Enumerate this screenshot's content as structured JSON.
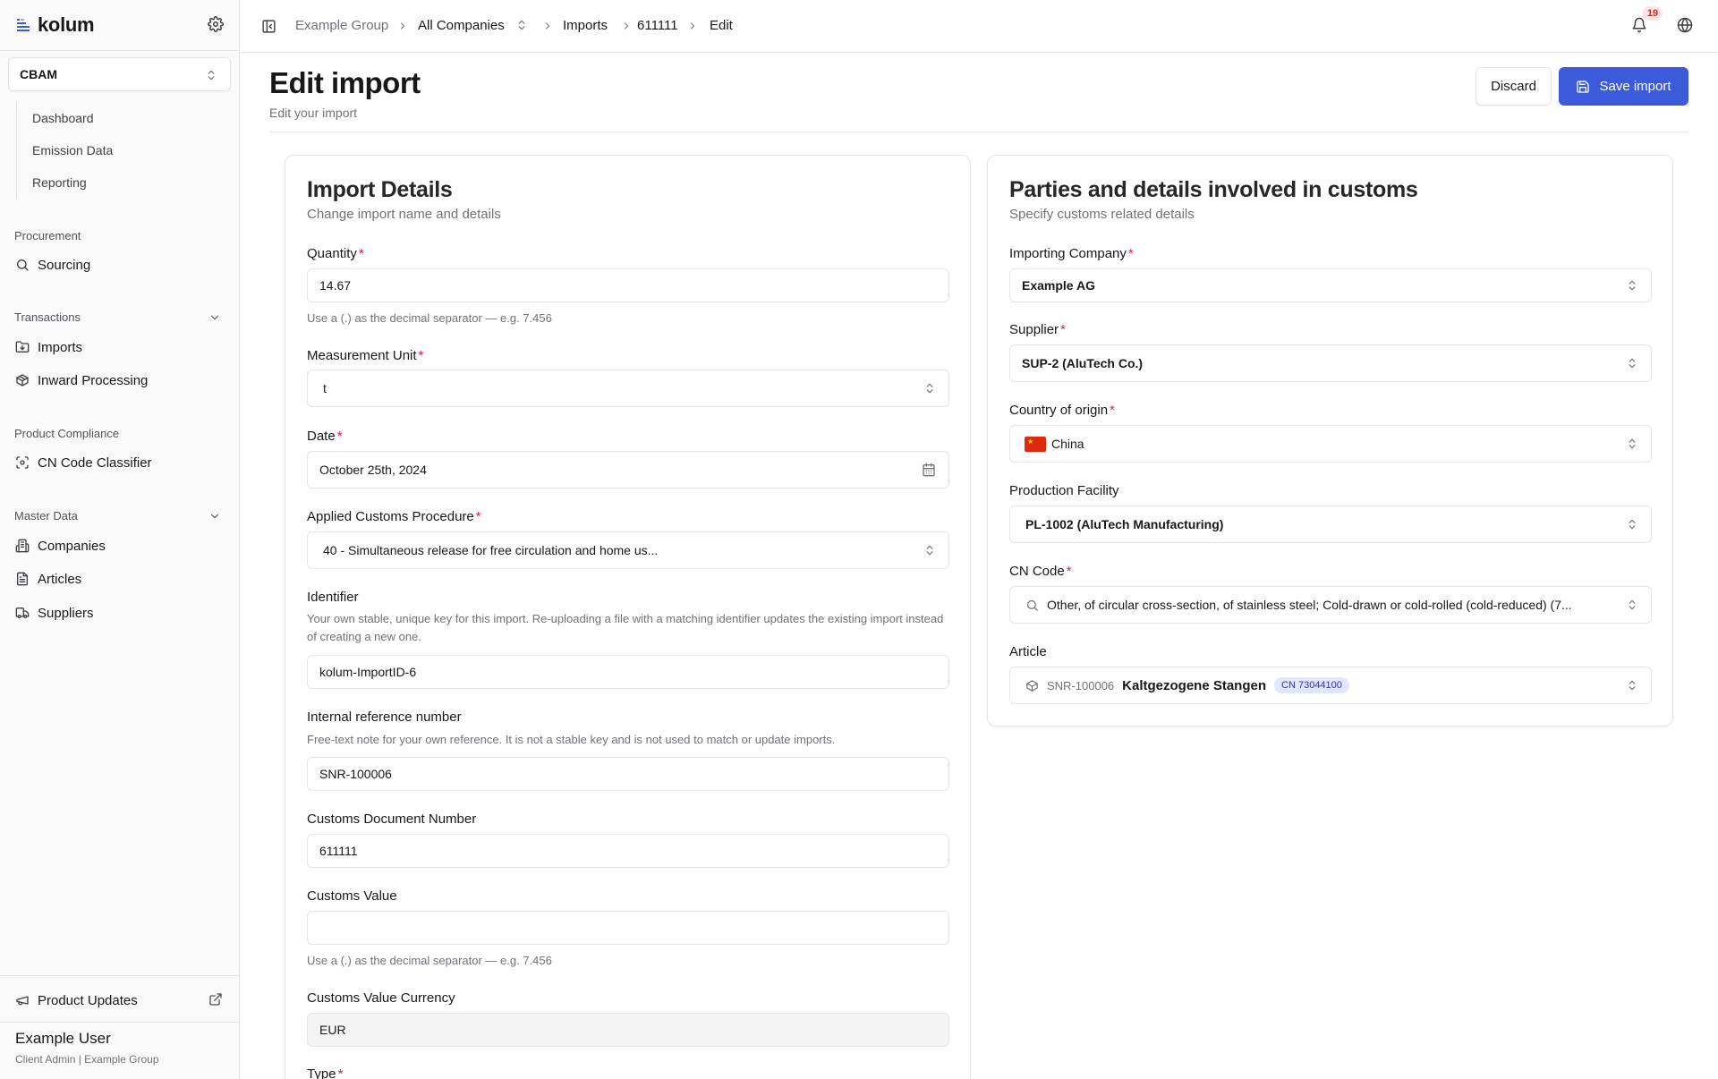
{
  "app": {
    "name": "kolum"
  },
  "sidebar": {
    "module": "CBAM",
    "module_items": [
      "Dashboard",
      "Emission Data",
      "Reporting"
    ],
    "groups": {
      "procurement": {
        "label": "Procurement",
        "items": [
          "Sourcing"
        ]
      },
      "transactions": {
        "label": "Transactions",
        "items": [
          "Imports",
          "Inward Processing"
        ]
      },
      "product_compliance": {
        "label": "Product Compliance",
        "items": [
          "CN Code Classifier"
        ]
      },
      "master_data": {
        "label": "Master Data",
        "items": [
          "Companies",
          "Articles",
          "Suppliers"
        ]
      }
    },
    "product_updates": "Product Updates",
    "user": {
      "name": "Example User",
      "role": "Client Admin | Example Group"
    }
  },
  "topbar": {
    "breadcrumb": [
      "Example Group",
      "All Companies",
      "Imports",
      "611111",
      "Edit"
    ],
    "notification_count": "19"
  },
  "page": {
    "title": "Edit import",
    "subtitle": "Edit your import",
    "discard_label": "Discard",
    "save_label": "Save import"
  },
  "import_details": {
    "title": "Import Details",
    "description": "Change import name and details",
    "quantity": {
      "label": "Quantity",
      "value": "14.67",
      "hint": "Use a (.) as the decimal separator — e.g. 7.456"
    },
    "measurement_unit": {
      "label": "Measurement Unit",
      "value": "t"
    },
    "date": {
      "label": "Date",
      "value": "October 25th, 2024"
    },
    "customs_procedure": {
      "label": "Applied Customs Procedure",
      "value": "40 - Simultaneous release for free circulation and home us..."
    },
    "identifier": {
      "label": "Identifier",
      "hint": "Your own stable, unique key for this import. Re-uploading a file with a matching identifier updates the existing import instead of creating a new one.",
      "value": "kolum-ImportID-6"
    },
    "internal_reference": {
      "label": "Internal reference number",
      "hint": "Free-text note for your own reference. It is not a stable key and is not used to match or update imports.",
      "value": "SNR-100006"
    },
    "customs_document_number": {
      "label": "Customs Document Number",
      "value": "611111"
    },
    "customs_value": {
      "label": "Customs Value",
      "value": "",
      "hint": "Use a (.) as the decimal separator — e.g. 7.456"
    },
    "customs_value_currency": {
      "label": "Customs Value Currency",
      "value": "EUR"
    },
    "type": {
      "label": "Type"
    }
  },
  "customs_parties": {
    "title": "Parties and details involved in customs",
    "description": "Specify customs related details",
    "importing_company": {
      "label": "Importing Company",
      "value": "Example AG"
    },
    "supplier": {
      "label": "Supplier",
      "value": "SUP-2 (AluTech Co.)"
    },
    "country_of_origin": {
      "label": "Country of origin",
      "value": "China"
    },
    "production_facility": {
      "label": "Production Facility",
      "value": "PL-1002 (AluTech Manufacturing)"
    },
    "cn_code": {
      "label": "CN Code",
      "value": "Other, of circular cross-section, of stainless steel; Cold-drawn or cold-rolled (cold-reduced) (7..."
    },
    "article": {
      "label": "Article",
      "id": "SNR-100006",
      "name": "Kaltgezogene Stangen",
      "cn_chip": "CN 73044100"
    }
  },
  "colors": {
    "primary": "#3b5bdb",
    "required": "#e11d48",
    "badge_text": "#dc2626",
    "flag_red": "#de2910"
  }
}
